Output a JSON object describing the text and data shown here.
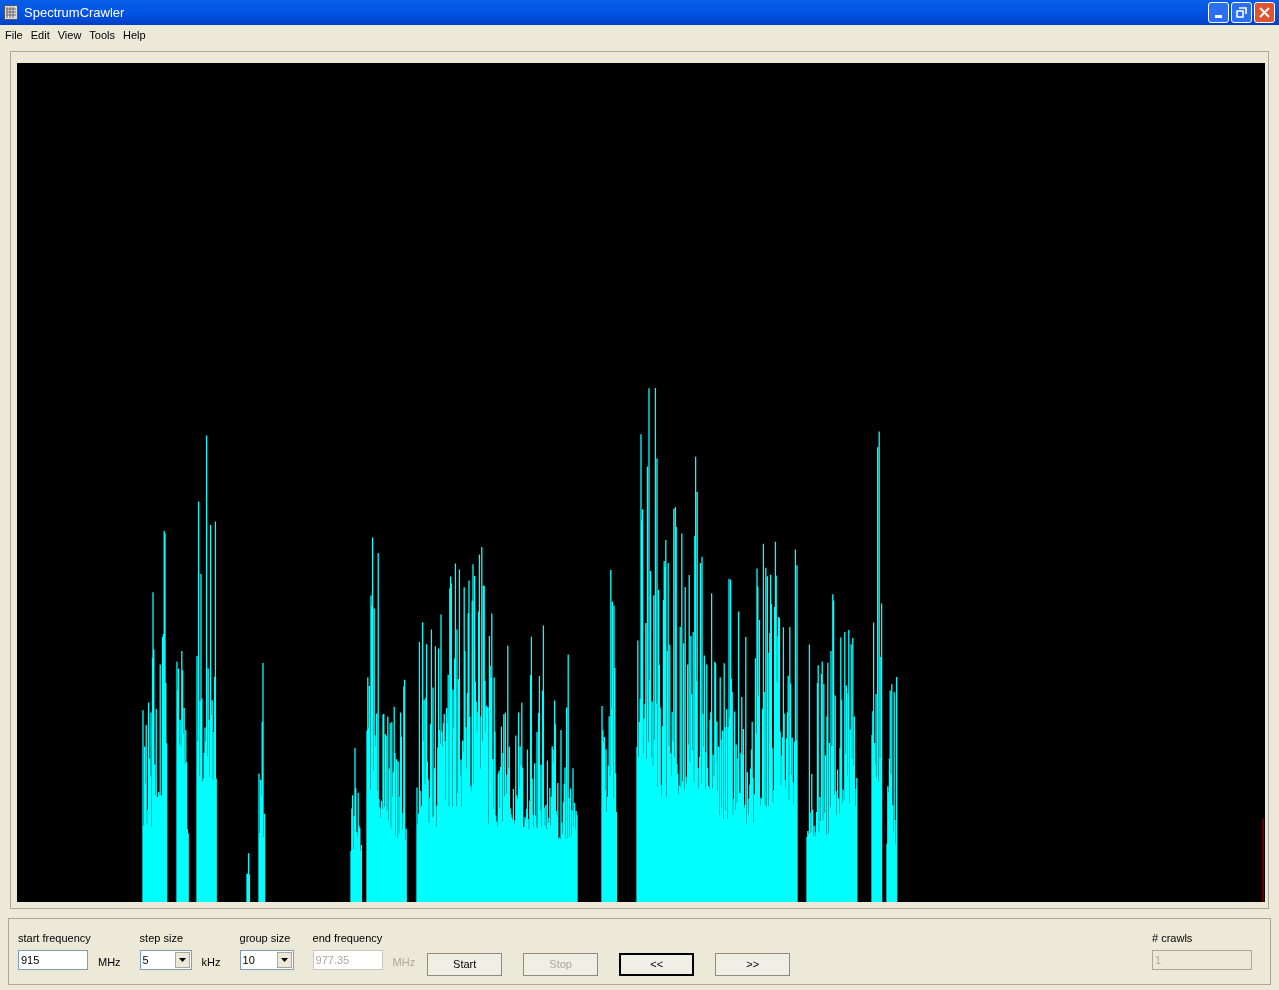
{
  "window": {
    "title": "SpectrumCrawler"
  },
  "menu": [
    "File",
    "Edit",
    "View",
    "Tools",
    "Help"
  ],
  "controls": [
    {
      "kind": "input",
      "label": "start frequency",
      "value": "915",
      "unit": "MHz",
      "disabled": false
    },
    {
      "kind": "select",
      "label": "step size",
      "value": "5",
      "unit": "kHz",
      "disabled": false
    },
    {
      "kind": "select",
      "label": "group size",
      "value": "10",
      "disabled": false
    },
    {
      "kind": "input",
      "label": "end frequency",
      "value": "977.35",
      "unit": "MHz",
      "disabled": true
    }
  ],
  "buttons": [
    {
      "label": "Start",
      "disabled": false,
      "default": false
    },
    {
      "label": "Stop",
      "disabled": true,
      "default": false
    },
    {
      "label": "<<",
      "disabled": false,
      "default": true
    },
    {
      "label": ">>",
      "disabled": false,
      "default": false
    }
  ],
  "crawls": {
    "label": "# crawls",
    "value": "1",
    "disabled": true
  }
}
